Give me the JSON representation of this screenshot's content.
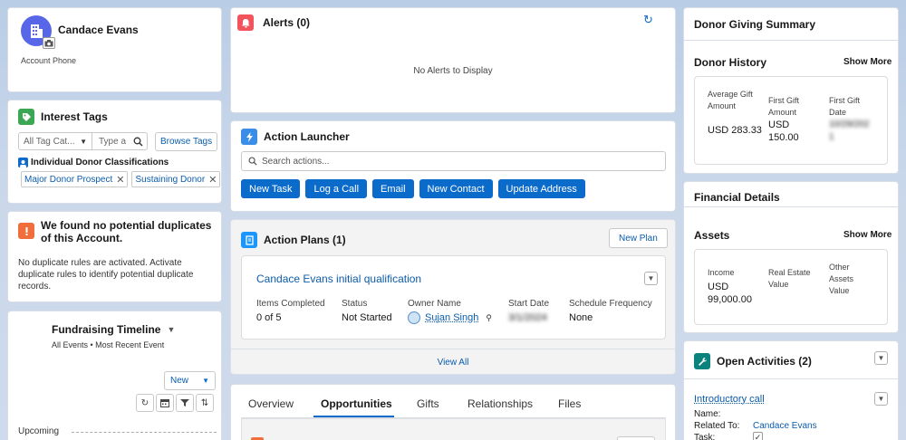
{
  "colors": {
    "brand_blue": "#0b6bcb",
    "link_blue": "#0b5cab",
    "account_icon": "#5867e8",
    "tag_icon": "#3ba755",
    "dup_icon": "#ef6e3c",
    "alert_icon": "#f2545b",
    "action_icon": "#1b96ff",
    "plan_icon": "#1b96ff",
    "activity_icon": "#0b827c"
  },
  "account": {
    "name": "Candace Evans",
    "phone_label": "Account Phone"
  },
  "interest_tags": {
    "title": "Interest Tags",
    "category_placeholder": "All Tag Cat...",
    "search_placeholder": "Type a",
    "browse_label": "Browse Tags",
    "group_label": "Individual Donor Classifications",
    "tags": [
      {
        "label": "Major Donor Prospect"
      },
      {
        "label": "Sustaining Donor"
      }
    ]
  },
  "duplicates": {
    "title": "We found no potential duplicates of this Account.",
    "body": "No duplicate rules are activated. Activate duplicate rules to identify potential duplicate records."
  },
  "timeline": {
    "title": "Fundraising Timeline",
    "subtitle": "All Events • Most Recent Event",
    "new_label": "New",
    "upcoming_label": "Upcoming"
  },
  "alerts": {
    "title": "Alerts (0)",
    "empty_text": "No Alerts to Display"
  },
  "action_launcher": {
    "title": "Action Launcher",
    "search_placeholder": "Search actions...",
    "actions": [
      {
        "label": "New Task"
      },
      {
        "label": "Log a Call"
      },
      {
        "label": "Email"
      },
      {
        "label": "New Contact"
      },
      {
        "label": "Update Address"
      }
    ]
  },
  "action_plans": {
    "title": "Action Plans (1)",
    "new_plan_label": "New Plan",
    "plan_name": "Candace Evans initial qualification",
    "items_completed_label": "Items Completed",
    "items_completed_value": "0 of 5",
    "status_label": "Status",
    "status_value": "Not Started",
    "owner_label": "Owner Name",
    "owner_value": "Sujan Singh",
    "start_date_label": "Start Date",
    "start_date_value": "3/1/2024",
    "frequency_label": "Schedule Frequency",
    "frequency_value": "None",
    "view_all_label": "View All"
  },
  "tabs": [
    {
      "label": "Overview"
    },
    {
      "label": "Opportunities"
    },
    {
      "label": "Gifts"
    },
    {
      "label": "Relationships"
    },
    {
      "label": "Files"
    }
  ],
  "giving_summary": {
    "title": "Donor Giving Summary"
  },
  "donor_history": {
    "title": "Donor History",
    "show_more_label": "Show More",
    "avg_label": "Average Gift Amount",
    "avg_value": "USD 283.33",
    "first_gift_label": "First Gift Amount",
    "first_gift_value": "USD 150.00",
    "first_date_label": "First Gift Date",
    "first_date_value": "10/29/2021"
  },
  "financial": {
    "title": "Financial Details",
    "assets_title": "Assets",
    "show_more_label": "Show More",
    "income_label": "Income",
    "income_value": "USD 99,000.00",
    "real_estate_label": "Real Estate Value",
    "other_assets_label": "Other Assets Value"
  },
  "activities": {
    "title": "Open Activities (2)",
    "item_title": "Introductory call",
    "name_label": "Name:",
    "related_label": "Related To:",
    "related_value": "Candace Evans",
    "task_label": "Task:"
  }
}
